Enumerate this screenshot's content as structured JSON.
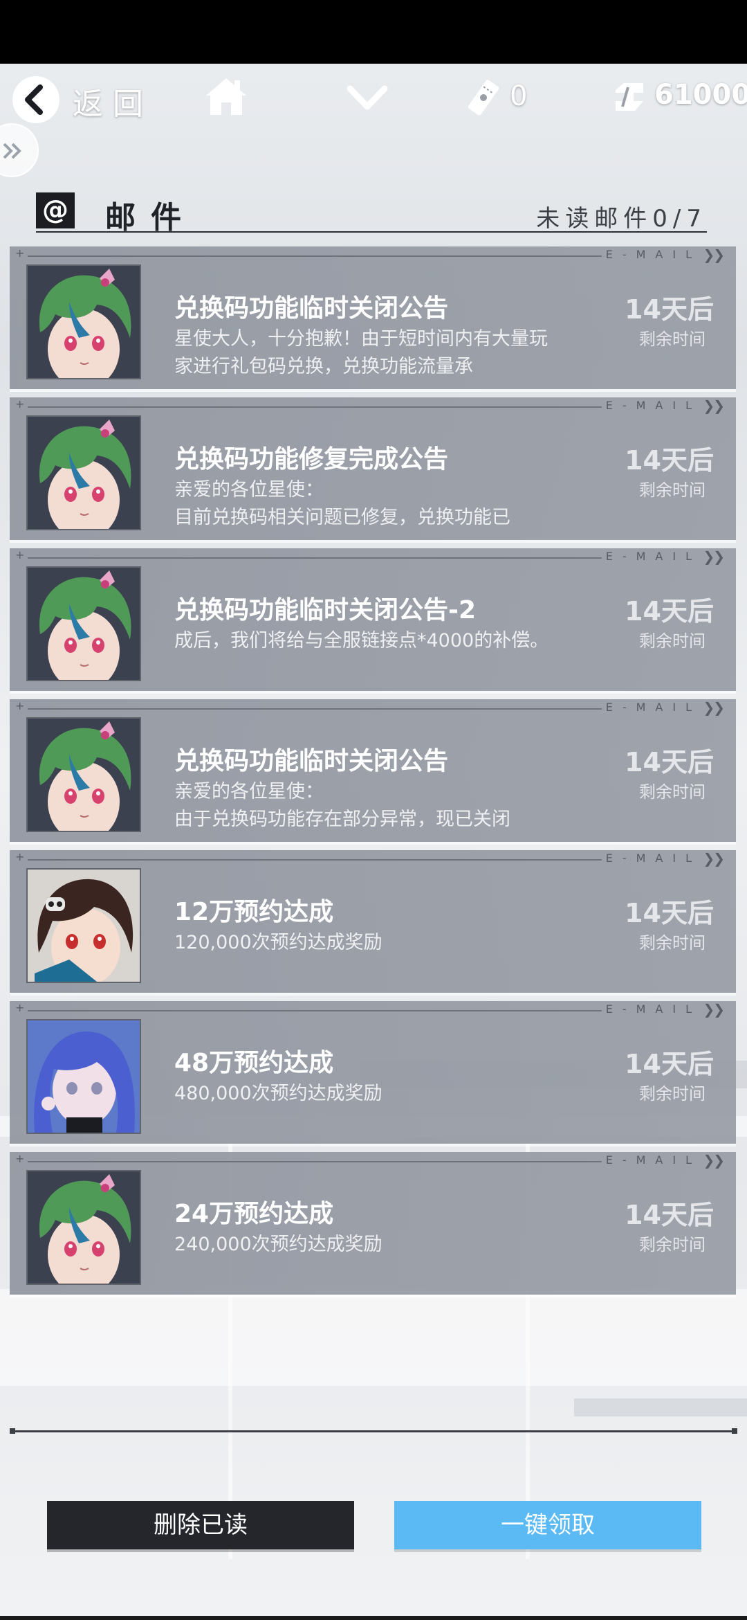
{
  "topbar": {
    "back_label": "返回",
    "ticket_count": "0",
    "coin_count": "61000"
  },
  "header": {
    "title": "邮件",
    "at_symbol": "@",
    "unread_text": "未读邮件0/7"
  },
  "mail_tag": "E-MAIL",
  "mails": [
    {
      "title": "兑换码功能临时关闭公告",
      "preview": "星使大人，十分抱歉！由于短时间内有大量玩家进行礼包码兑换，兑换功能流量承",
      "days": "14天后",
      "days_label": "剩余时间",
      "avatar": "green-hair-avatar"
    },
    {
      "title": "兑换码功能修复完成公告",
      "preview": "亲爱的各位星使：\n目前兑换码相关问题已修复，兑换功能已",
      "days": "14天后",
      "days_label": "剩余时间",
      "avatar": "green-hair-avatar"
    },
    {
      "title": "兑换码功能临时关闭公告-2",
      "preview": "成后，我们将给与全服链接点*4000的补偿。",
      "days": "14天后",
      "days_label": "剩余时间",
      "avatar": "green-hair-avatar"
    },
    {
      "title": "兑换码功能临时关闭公告",
      "preview": "亲爱的各位星使：\n由于兑换码功能存在部分异常，现已关闭",
      "days": "14天后",
      "days_label": "剩余时间",
      "avatar": "green-hair-avatar"
    },
    {
      "title": "12万预约达成",
      "preview": "120,000次预约达成奖励",
      "days": "14天后",
      "days_label": "剩余时间",
      "avatar": "brown-hair-avatar"
    },
    {
      "title": "48万预约达成",
      "preview": "480,000次预约达成奖励",
      "days": "14天后",
      "days_label": "剩余时间",
      "avatar": "blue-hair-avatar"
    },
    {
      "title": "24万预约达成",
      "preview": "240,000次预约达成奖励",
      "days": "14天后",
      "days_label": "剩余时间",
      "avatar": "green-hair-avatar"
    }
  ],
  "footer": {
    "delete_read_label": "删除已读",
    "claim_all_label": "一键领取"
  },
  "colors": {
    "claim_button": "#5bbaf3",
    "delete_button": "#24262c",
    "card": "#959aa3"
  }
}
